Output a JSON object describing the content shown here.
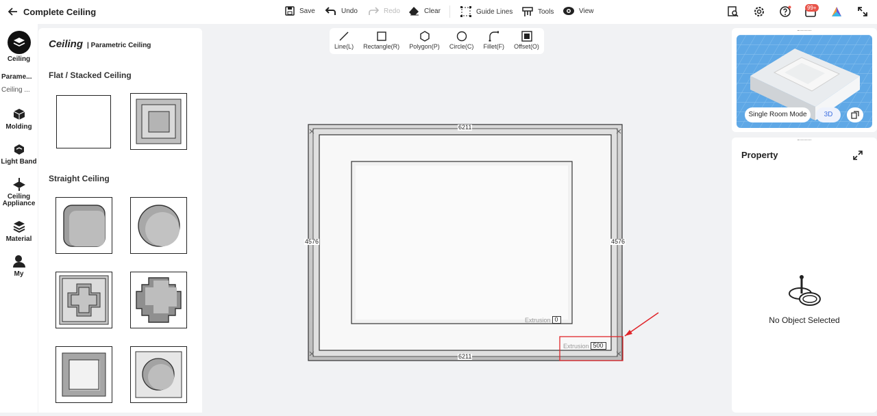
{
  "header": {
    "back_title": "Complete Ceiling",
    "toolbar": {
      "save": "Save",
      "undo": "Undo",
      "redo": "Redo",
      "clear": "Clear",
      "guide_lines": "Guide Lines",
      "tools": "Tools",
      "view": "View"
    },
    "notifications_badge": "99+"
  },
  "left_nav": {
    "items": [
      {
        "label": "Ceiling"
      },
      {
        "label": "Parame..."
      },
      {
        "label": "Ceiling ..."
      },
      {
        "label": "Molding"
      },
      {
        "label": "Light Band"
      },
      {
        "label": "Ceiling Appliance"
      },
      {
        "label": "Material"
      },
      {
        "label": "My"
      }
    ]
  },
  "library_panel": {
    "title": "Ceiling",
    "subtitle": "| Parametric Ceiling",
    "sections": [
      {
        "title": "Flat / Stacked Ceiling"
      },
      {
        "title": "Straight Ceiling"
      }
    ]
  },
  "draw_tools": [
    {
      "label": "Line(L)",
      "icon": "line-icon"
    },
    {
      "label": "Rectangle(R)",
      "icon": "rectangle-icon"
    },
    {
      "label": "Polygon(P)",
      "icon": "polygon-icon"
    },
    {
      "label": "Circle(C)",
      "icon": "circle-icon"
    },
    {
      "label": "Fillet(F)",
      "icon": "fillet-icon"
    },
    {
      "label": "Offset(O)",
      "icon": "offset-icon"
    }
  ],
  "canvas": {
    "dim_top": "6211",
    "dim_bottom": "6211",
    "dim_left": "4576",
    "dim_right": "4576",
    "inner_extrusion_label": "Extrusion",
    "inner_extrusion_value": "0",
    "outer_extrusion_label": "Extrusion",
    "outer_extrusion_value": "500",
    "highlight_color": "#e0262b"
  },
  "preview": {
    "mode_label": "Single Room Mode",
    "view_label": "3D"
  },
  "property": {
    "title": "Property",
    "empty_text": "No Object Selected"
  }
}
